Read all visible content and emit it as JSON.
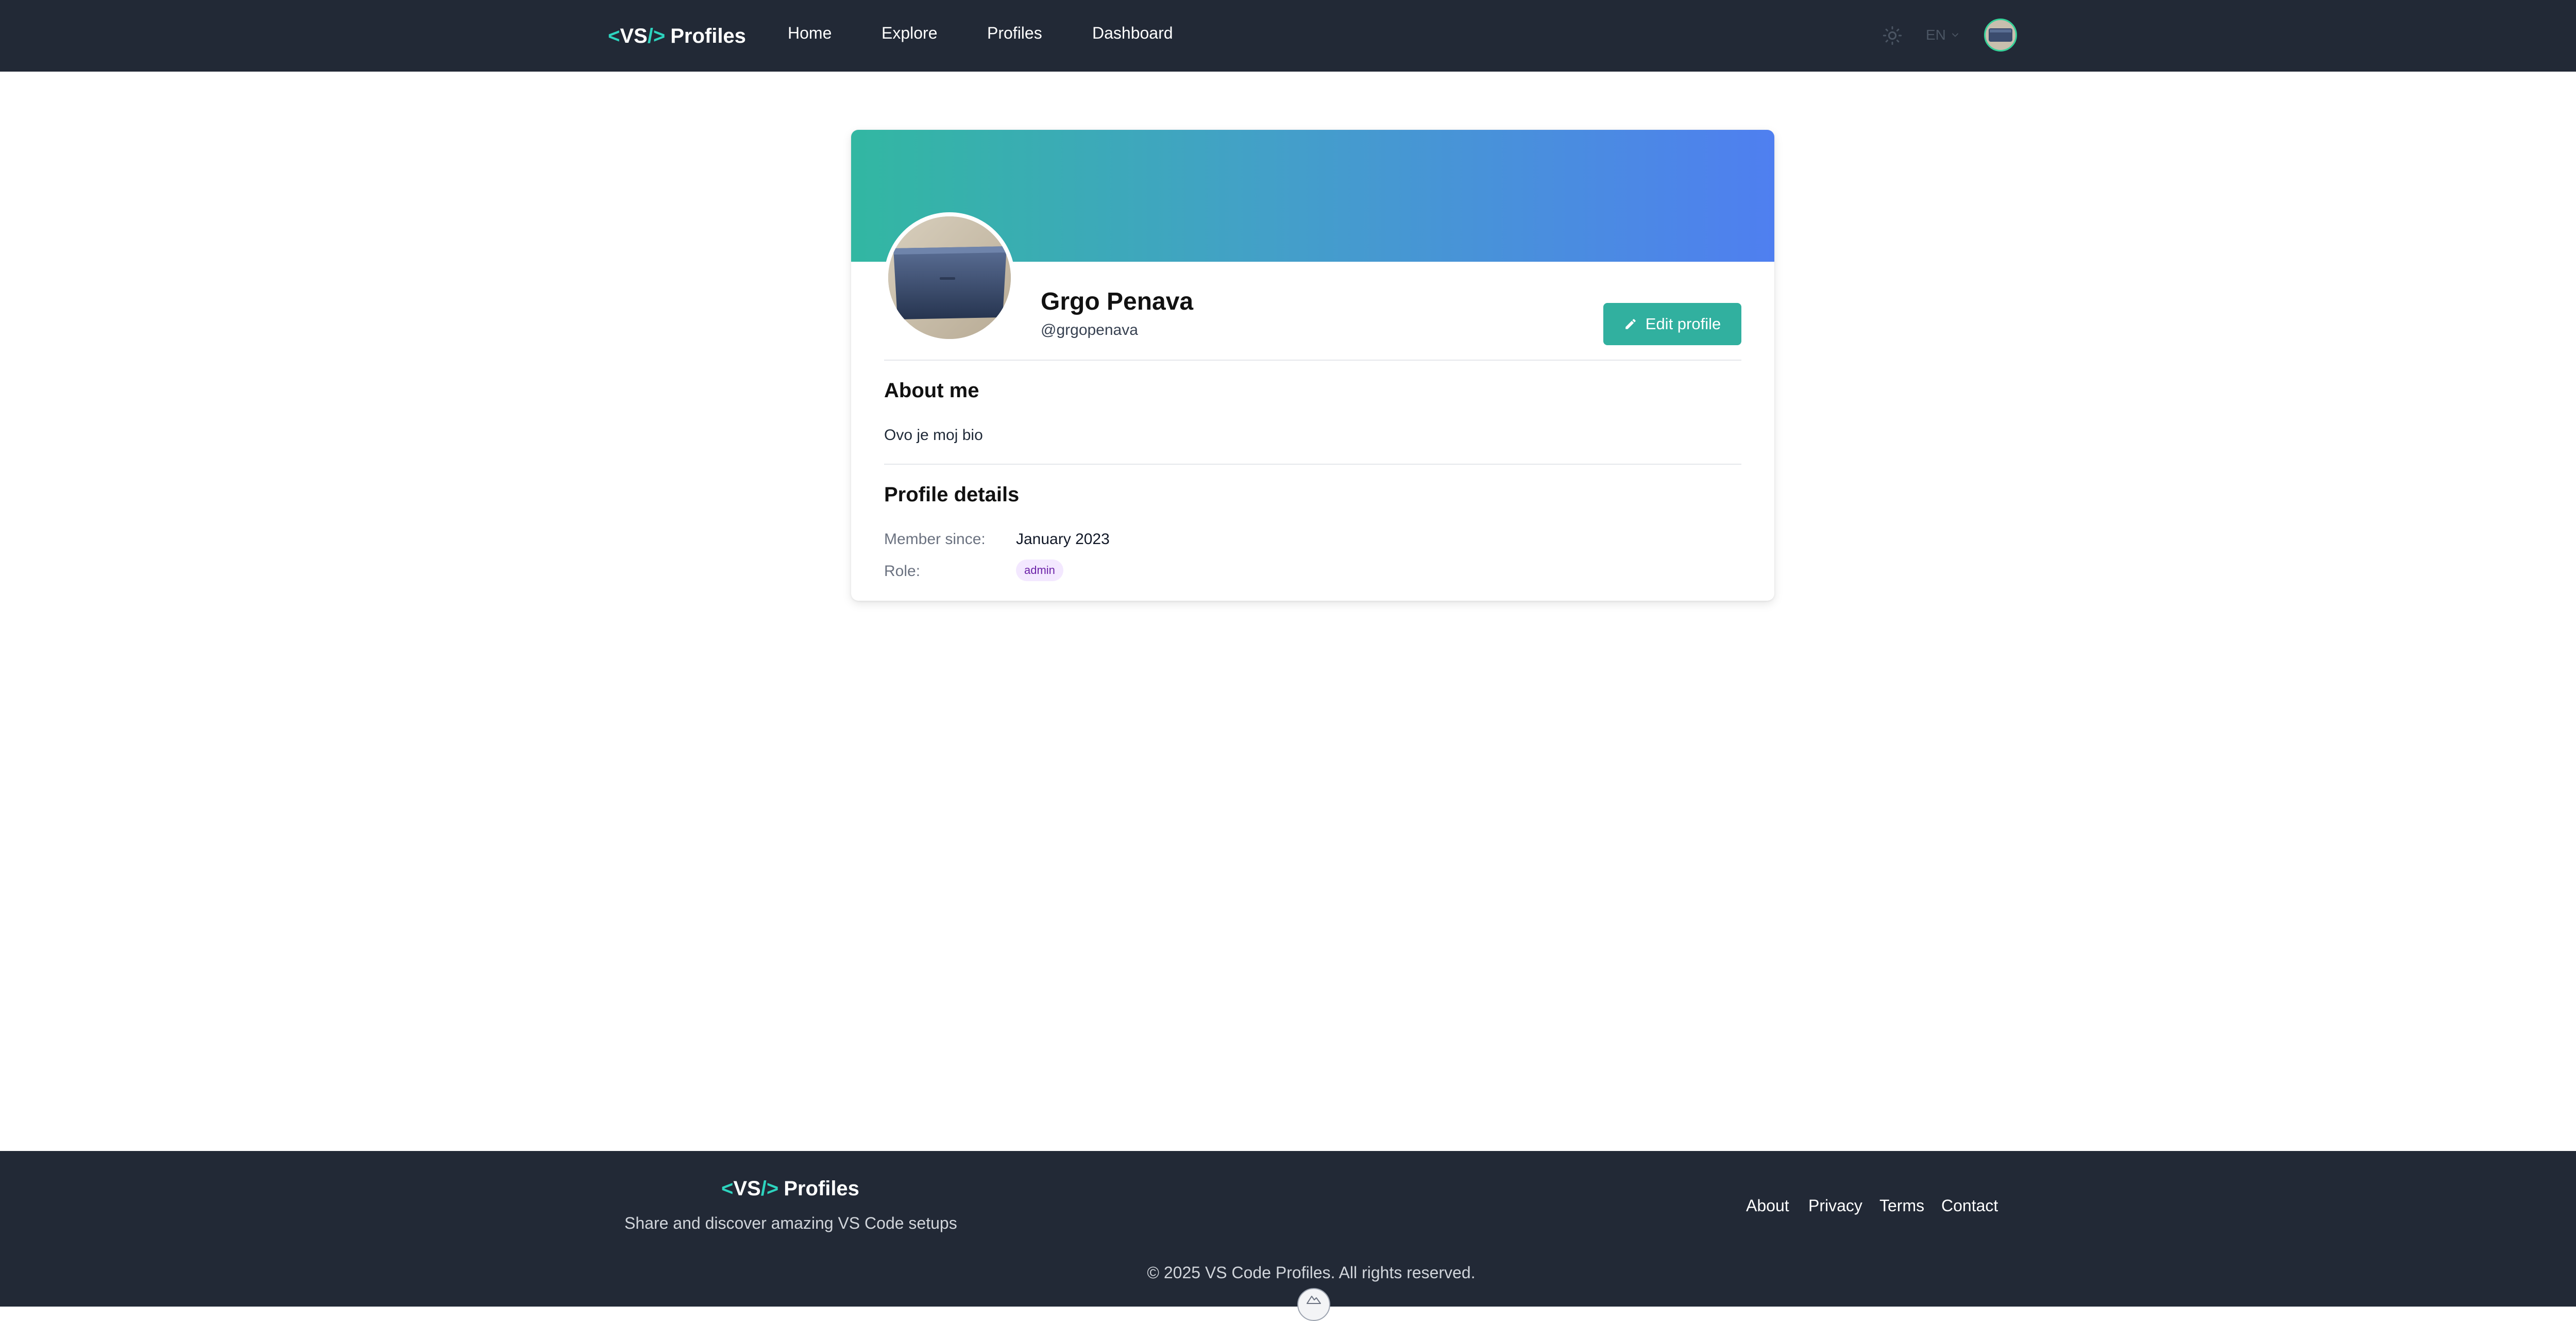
{
  "nav": {
    "logo": {
      "bracket_open": "<",
      "vs": "VS",
      "bracket_close": "/>",
      "word": "Profiles"
    },
    "links": [
      "Home",
      "Explore",
      "Profiles",
      "Dashboard"
    ],
    "language": "EN",
    "icons": {
      "theme": "sun-icon",
      "language": "chevron-down-icon"
    }
  },
  "profile": {
    "name": "Grgo Penava",
    "handle": "@grgopenava",
    "edit_label": "Edit profile",
    "edit_icon": "pencil-icon",
    "about_title": "About me",
    "bio": "Ovo je moj bio",
    "details_title": "Profile details",
    "member_since_label": "Member since:",
    "member_since_value": "January 2023",
    "role_label": "Role:",
    "role_value": "admin"
  },
  "footer": {
    "logo": {
      "bracket_open": "<",
      "vs": "VS",
      "bracket_close": "/>",
      "word": "Profiles"
    },
    "tagline": "Share and discover amazing VS Code setups",
    "links": [
      "About",
      "Privacy",
      "Terms",
      "Contact"
    ],
    "copyright": "© 2025 VS Code Profiles. All rights reserved."
  },
  "colors": {
    "navbar": "#222936",
    "accent": "#2dd4bf",
    "button": "#31b09f",
    "cover_start": "#32b7a2",
    "cover_end": "#4f7ff0",
    "badge_bg": "#f3e8ff",
    "badge_text": "#6b21a8"
  }
}
